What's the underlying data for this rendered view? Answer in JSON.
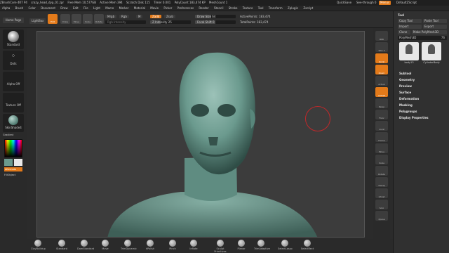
{
  "titlebar": {
    "app": "ZBrushCore 4R7 P4",
    "file": "crazy_head_dyp_01.zpr",
    "free_mem": "Free Mem 10,577GB",
    "active_mem": "Active Mem 394",
    "scratch_disk": "Scratch Disk 115",
    "timer": "Timer 0.001",
    "poly_count": "PolyCount 183,474 KP",
    "mesh_count": "MeshCount 1",
    "quicksave": "QuickSave",
    "see_through": "See-through 0",
    "menus": "Menus",
    "default_script": "DefaultZScript"
  },
  "menubar": [
    "Alpha",
    "Brush",
    "Color",
    "Document",
    "Draw",
    "Edit",
    "File",
    "Light",
    "Macro",
    "Marker",
    "Material",
    "Movie",
    "Picker",
    "Preferences",
    "Render",
    "Stencil",
    "Stroke",
    "Texture",
    "Tool",
    "Transform",
    "Zplugin",
    "Zscript"
  ],
  "toolbar": {
    "mode_buttons": [
      "Edit",
      "Draw",
      "Move",
      "Scale",
      "Rotate"
    ],
    "mrgb": "Mrgb",
    "rgb": "Rgb",
    "m": "M",
    "zadd": "Zadd",
    "zsub": "Zsub",
    "rgb_intensity": "Rgb Intensity",
    "z_intensity": "Z Intensity 25",
    "focal_shift": "Focal Shift 0",
    "draw_size": "Draw Size 64",
    "active_points": "ActivePoints: 183,474",
    "total_points": "TotalPoints: 183,474"
  },
  "leftshelf": {
    "home_page": "Home Page",
    "lightbox": "LightBox",
    "brush_name": "Standard",
    "stroke_name": "Dots",
    "alpha_name": "Alpha Off",
    "texture_name": "Texture Off",
    "material_name": "SkinShade4",
    "gradient": "Gradient",
    "switch_color": "SwitchColor",
    "alternate": "Alternate",
    "fill_object": "FillObject"
  },
  "rightshelf": [
    "BPR",
    "SPix 3",
    "Scroll",
    "Zoom",
    "Actual",
    "AAHalf",
    "Persp",
    "Floor",
    "Local",
    "Frame",
    "Move",
    "Scale",
    "Rotate",
    "Transp",
    "Ghost",
    "Solo",
    "Xpose"
  ],
  "toolpanel": {
    "title": "Tool",
    "copy_tool": "Copy Tool",
    "paste_tool": "Paste Tool",
    "import": "Import",
    "export": "Export",
    "clone": "Clone",
    "make_polymesh": "Make PolyMesh3D",
    "polymesh_slider": "PolyMesh3D",
    "slider_value": "76",
    "thumb1": "body13",
    "thumb2": "CylinderBody",
    "sections": [
      "Subtool",
      "Geometry",
      "Preview",
      "Surface",
      "Deformation",
      "Masking",
      "Polygroups",
      "Display Properties"
    ]
  },
  "bottombar": [
    "ClayBuildup",
    "Standard",
    "DamStandard",
    "Move",
    "TrimDynamic",
    "hPolish",
    "Pinch",
    "Inflate",
    "Sculpt Primitives",
    "Planar",
    "TrimAdaptive",
    "SelectLasso",
    "SelectRect"
  ],
  "colors": {
    "accent": "#e37a1a",
    "skin": "#6b9a8e",
    "canvas": "#3c3c3c"
  }
}
